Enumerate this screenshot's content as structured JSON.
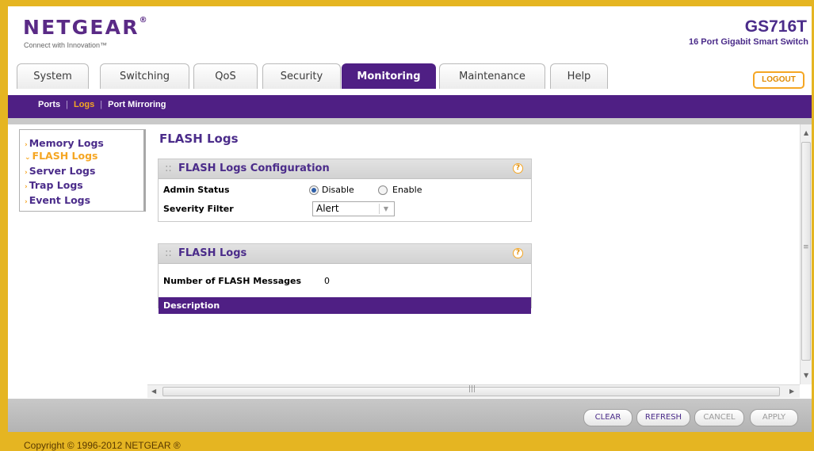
{
  "header": {
    "logo": "NETGEAR",
    "logo_mark": "®",
    "tagline": "Connect with Innovation™",
    "model": "GS716T",
    "model_description": "16 Port Gigabit Smart Switch",
    "logout_label": "LOGOUT"
  },
  "tabs": [
    {
      "label": "System",
      "active": false
    },
    {
      "label": "Switching",
      "active": false
    },
    {
      "label": "QoS",
      "active": false
    },
    {
      "label": "Security",
      "active": false
    },
    {
      "label": "Monitoring",
      "active": true
    },
    {
      "label": "Maintenance",
      "active": false
    },
    {
      "label": "Help",
      "active": false
    }
  ],
  "subnav": {
    "items": [
      {
        "label": "Ports",
        "active": false
      },
      {
        "label": "Logs",
        "active": true
      },
      {
        "label": "Port Mirroring",
        "active": false
      }
    ],
    "separator": "|"
  },
  "left_menu": {
    "items": [
      {
        "label": "Memory Logs",
        "active": false,
        "marker": "›"
      },
      {
        "label": "FLASH Logs",
        "active": true,
        "marker": "⌄"
      },
      {
        "label": "Server Logs",
        "active": false,
        "marker": "›"
      },
      {
        "label": "Trap Logs",
        "active": false,
        "marker": "›"
      },
      {
        "label": "Event Logs",
        "active": false,
        "marker": "›"
      }
    ]
  },
  "page": {
    "title": "FLASH Logs"
  },
  "config_panel": {
    "title": "FLASH Logs Configuration",
    "help_glyph": "?",
    "admin_status_label": "Admin Status",
    "admin_status_options": [
      {
        "label": "Disable",
        "checked": true
      },
      {
        "label": "Enable",
        "checked": false
      }
    ],
    "severity_filter_label": "Severity Filter",
    "severity_filter_value": "Alert"
  },
  "logs_panel": {
    "title": "FLASH Logs",
    "help_glyph": "?",
    "count_label": "Number of FLASH Messages",
    "count_value": "0",
    "column_header": "Description"
  },
  "buttons": {
    "clear": "CLEAR",
    "refresh": "REFRESH",
    "cancel": "CANCEL",
    "apply": "APPLY"
  },
  "footer": {
    "copyright": "Copyright © 1996-2012 NETGEAR ®"
  },
  "colors": {
    "brand_purple": "#4F1F84",
    "accent_orange": "#F5A623",
    "frame_gold": "#E5B522"
  }
}
